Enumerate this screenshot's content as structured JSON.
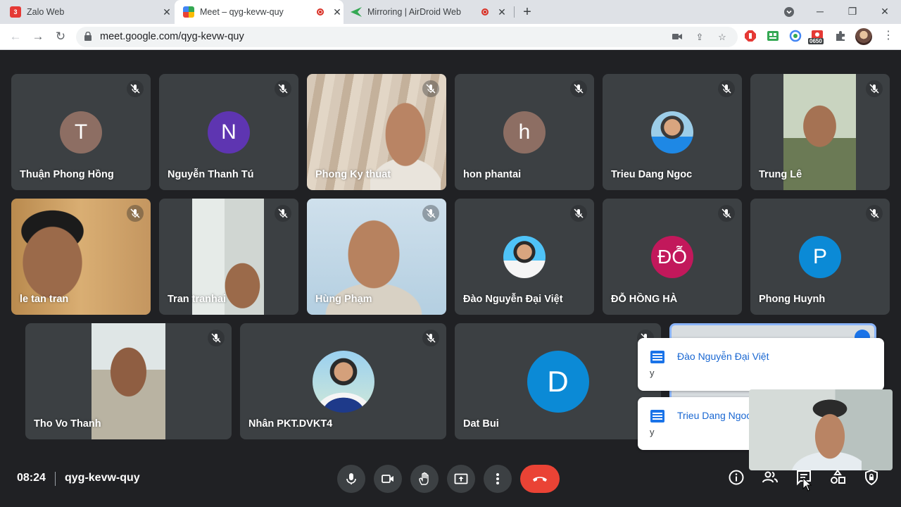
{
  "browser": {
    "tabs": [
      {
        "title": "Zalo Web",
        "badge": "3"
      },
      {
        "title": "Meet – qyg-kevw-quy"
      },
      {
        "title": "Mirroring | AirDroid Web"
      }
    ],
    "url": "meet.google.com/qyg-kevw-quy",
    "ext_badge": "0650"
  },
  "participants": [
    {
      "name": "Thuận Phong Hồng",
      "initial": "T",
      "color": "#8d6e63"
    },
    {
      "name": "Nguyễn Thanh Tú",
      "initial": "N",
      "color": "#5e35b1"
    },
    {
      "name": "Phong Ky thuat"
    },
    {
      "name": "hon phantai",
      "initial": "h",
      "color": "#8d6e63"
    },
    {
      "name": "Trieu Dang Ngoc"
    },
    {
      "name": "Trung Lê"
    },
    {
      "name": "le tan tran"
    },
    {
      "name": "Tran tranhai"
    },
    {
      "name": "Hùng Phạm"
    },
    {
      "name": "Đào Nguyễn Đại Việt"
    },
    {
      "name": "ĐỖ HỒNG HÀ",
      "initial": "ĐỖ",
      "color": "#c2185b"
    },
    {
      "name": "Phong Huynh",
      "initial": "P",
      "color": "#0b8ad6"
    },
    {
      "name": "Tho Vo Thanh"
    },
    {
      "name": "Nhân PKT.DVKT4"
    },
    {
      "name": "Dat Bui",
      "initial": "D",
      "color": "#0b8ad6"
    }
  ],
  "chat_notifications": [
    {
      "sender": "Đào Nguyễn Đại Việt",
      "message": "y"
    },
    {
      "sender": "Trieu Dang Ngoc",
      "message": "y"
    }
  ],
  "meeting": {
    "time": "08:24",
    "code": "qyg-kevw-quy"
  },
  "colors": {
    "background": "#202124",
    "tile": "#3c4043",
    "hangup": "#ea4335",
    "accent": "#1a73e8"
  }
}
